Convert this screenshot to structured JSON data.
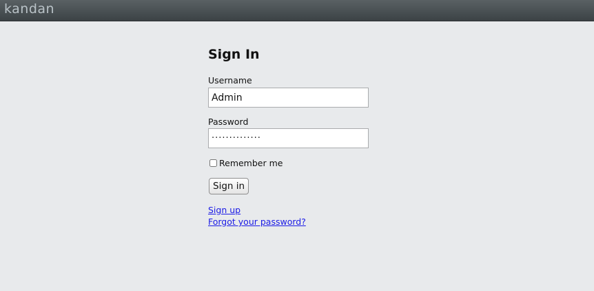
{
  "app": {
    "logo_text": "kandan"
  },
  "signin": {
    "title": "Sign In",
    "username_label": "Username",
    "username_value": "Admin",
    "password_label": "Password",
    "password_value": "··············",
    "remember_label": "Remember me",
    "remember_checked": false,
    "submit_label": "Sign in",
    "links": {
      "signup": "Sign up",
      "forgot": "Forgot your password?"
    }
  },
  "colors": {
    "background": "#e8eaec",
    "topbar": "#4a5053",
    "link": "#1a1ae6"
  }
}
